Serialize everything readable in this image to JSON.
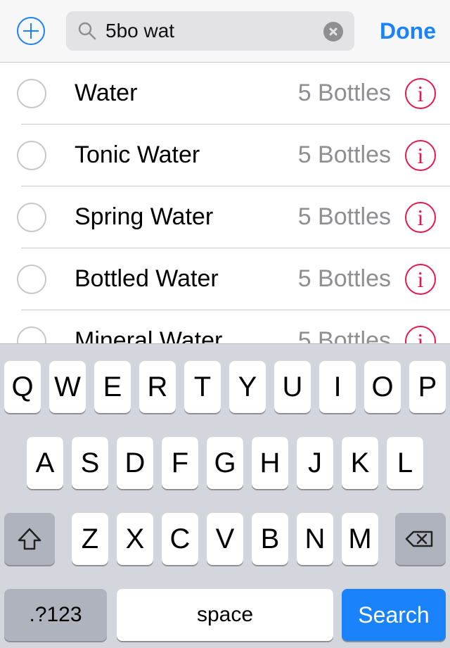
{
  "header": {
    "add_icon": "plus-circle-icon",
    "search": {
      "value": "5bo wat",
      "icon": "search-icon",
      "clear_icon": "clear-icon"
    },
    "done_label": "Done"
  },
  "list": [
    {
      "name": "Water",
      "quantity": "5 Bottles",
      "info_icon": "info-icon",
      "info_glyph": "i"
    },
    {
      "name": "Tonic Water",
      "quantity": "5 Bottles",
      "info_icon": "info-icon",
      "info_glyph": "i"
    },
    {
      "name": "Spring Water",
      "quantity": "5 Bottles",
      "info_icon": "info-icon",
      "info_glyph": "i"
    },
    {
      "name": "Bottled Water",
      "quantity": "5 Bottles",
      "info_icon": "info-icon",
      "info_glyph": "i"
    },
    {
      "name": "Mineral Water",
      "quantity": "5 Bottles",
      "info_icon": "info-icon",
      "info_glyph": "i"
    }
  ],
  "colors": {
    "accent": "#1a82fb",
    "info": "#e8174d",
    "secondary_text": "#8e8e93"
  },
  "keyboard": {
    "row1": [
      "Q",
      "W",
      "E",
      "R",
      "T",
      "Y",
      "U",
      "I",
      "O",
      "P"
    ],
    "row2": [
      "A",
      "S",
      "D",
      "F",
      "G",
      "H",
      "J",
      "K",
      "L"
    ],
    "row3": [
      "Z",
      "X",
      "C",
      "V",
      "B",
      "N",
      "M"
    ],
    "shift_icon": "shift-icon",
    "delete_icon": "delete-icon",
    "numbers_label": ".?123",
    "space_label": "space",
    "search_label": "Search"
  }
}
